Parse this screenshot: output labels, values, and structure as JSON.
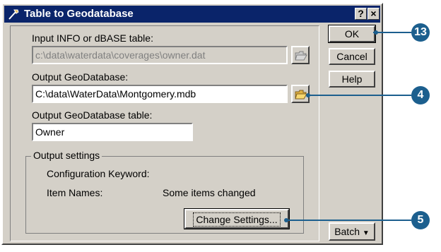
{
  "window": {
    "title": "Table to Geodatabase",
    "help_button": "?",
    "close_button": "×"
  },
  "input_table": {
    "label": "Input INFO or dBASE table:",
    "value": "c:\\data\\waterdata\\coverages\\owner.dat"
  },
  "output_gdb": {
    "label": "Output GeoDatabase:",
    "value": "C:\\data\\WaterData\\Montgomery.mdb"
  },
  "output_table": {
    "label": "Output GeoDatabase table:",
    "value": "Owner"
  },
  "output_settings": {
    "title": "Output settings",
    "config_keyword_label": "Configuration Keyword:",
    "item_names_label": "Item Names:",
    "item_names_value": "Some items changed",
    "change_settings_button": "Change Settings..."
  },
  "buttons": {
    "ok": "OK",
    "cancel": "Cancel",
    "help": "Help",
    "batch": "Batch",
    "batch_arrow": "▼"
  },
  "callouts": {
    "ok": "13",
    "browse": "4",
    "change_settings": "5"
  },
  "colors": {
    "dialog_face": "#d4d0c8",
    "titlebar": "#0a246a",
    "callout": "#1c5f8e"
  }
}
